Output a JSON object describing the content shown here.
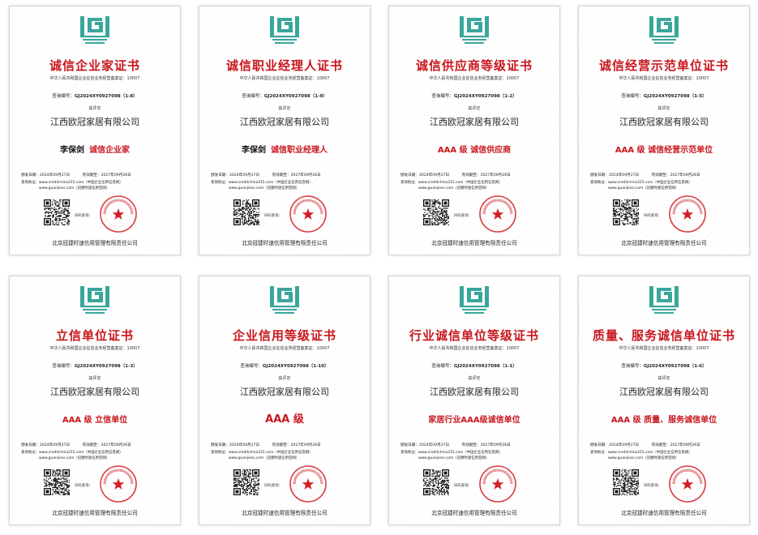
{
  "theme": {
    "title_color": "#c8161d",
    "logo_color": "#3aa69c",
    "seal_color": "#d21e26"
  },
  "certificates": [
    {
      "title": "诚信企业家证书",
      "subtitle": "中华人民共和国企业征信业务经营备案证：10007",
      "query_label": "查询编号：",
      "query_no": "GJ2024XY0927098（1-8）",
      "awarded_label": "兹评定",
      "company": "江西欧冠家居有限公司",
      "person": "李保剑",
      "honor": "诚信企业家",
      "issue_label": "颁发日期：",
      "issue_date": "2024年09月27日",
      "valid_label": "有效期至：",
      "valid_date": "2027年09月26日",
      "site_label": "查询地址：",
      "site_1": "www.creditchina315.com（中国企业信用信息网）",
      "site_2": "www.guanjiess.com（冠捷时速信用官网）",
      "scan_label": "扫码查询：",
      "issuer": "北京冠捷时速信用管理有限责任公司",
      "logo_icon": "organization-logo-icon",
      "qr_icon": "qr-code-icon",
      "seal_icon": "red-seal-stamp-icon"
    },
    {
      "title": "诚信职业经理人证书",
      "subtitle": "中华人民共和国企业征信业务经营备案证：10007",
      "query_label": "查询编号：",
      "query_no": "GJ2024XY0927098（1-9）",
      "awarded_label": "兹评定",
      "company": "江西欧冠家居有限公司",
      "person": "李保剑",
      "honor": "诚信职业经理人",
      "issue_label": "颁发日期：",
      "issue_date": "2024年09月27日",
      "valid_label": "有效期至：",
      "valid_date": "2027年09月26日",
      "site_label": "查询地址：",
      "site_1": "www.creditchina315.com（中国企业信用信息网）",
      "site_2": "www.guanjiess.com（冠捷时速信用官网）",
      "scan_label": "扫码查询：",
      "issuer": "北京冠捷时速信用管理有限责任公司",
      "logo_icon": "organization-logo-icon",
      "qr_icon": "qr-code-icon",
      "seal_icon": "red-seal-stamp-icon"
    },
    {
      "title": "诚信供应商等级证书",
      "subtitle": "中华人民共和国企业征信业务经营备案证：10007",
      "query_label": "查询编号：",
      "query_no": "GJ2024XY0927098（1-2）",
      "awarded_label": "兹评定",
      "company": "江西欧冠家居有限公司",
      "person": "",
      "honor": "AAA 级  诚信供应商",
      "issue_label": "颁发日期：",
      "issue_date": "2024年09月27日",
      "valid_label": "有效期至：",
      "valid_date": "2027年09月26日",
      "site_label": "查询地址：",
      "site_1": "www.creditchina315.com（中国企业信用信息网）",
      "site_2": "www.guanjiess.com（冠捷时速信用官网）",
      "scan_label": "扫码查询：",
      "issuer": "北京冠捷时速信用管理有限责任公司",
      "logo_icon": "organization-logo-icon",
      "qr_icon": "qr-code-icon",
      "seal_icon": "red-seal-stamp-icon"
    },
    {
      "title": "诚信经营示范单位证书",
      "subtitle": "中华人民共和国企业征信业务经营备案证：10007",
      "query_label": "查询编号：",
      "query_no": "GJ2024XY0927098（1-5）",
      "awarded_label": "兹评定",
      "company": "江西欧冠家居有限公司",
      "person": "",
      "honor": "AAA 级  诚信经营示范单位",
      "issue_label": "颁发日期：",
      "issue_date": "2024年09月27日",
      "valid_label": "有效期至：",
      "valid_date": "2027年09月26日",
      "site_label": "查询地址：",
      "site_1": "www.creditchina315.com（中国企业信用信息网）",
      "site_2": "www.guanjiess.com（冠捷时速信用官网）",
      "scan_label": "扫码查询：",
      "issuer": "北京冠捷时速信用管理有限责任公司",
      "logo_icon": "organization-logo-icon",
      "qr_icon": "qr-code-icon",
      "seal_icon": "red-seal-stamp-icon"
    },
    {
      "title": "立信单位证书",
      "subtitle": "中华人民共和国企业征信业务经营备案证：10007",
      "query_label": "查询编号：",
      "query_no": "GJ2024XY0927098（1-3）",
      "awarded_label": "兹评定",
      "company": "江西欧冠家居有限公司",
      "person": "",
      "honor": "AAA 级  立信单位",
      "issue_label": "颁发日期：",
      "issue_date": "2024年09月27日",
      "valid_label": "有效期至：",
      "valid_date": "2027年09月26日",
      "site_label": "查询地址：",
      "site_1": "www.creditchina315.com（中国企业信用信息网）",
      "site_2": "www.guanjiess.com（冠捷时速信用官网）",
      "scan_label": "扫码查询：",
      "issuer": "北京冠捷时速信用管理有限责任公司",
      "logo_icon": "organization-logo-icon",
      "qr_icon": "qr-code-icon",
      "seal_icon": "red-seal-stamp-icon"
    },
    {
      "title": "企业信用等级证书",
      "subtitle": "中华人民共和国企业征信业务经营备案证：10007",
      "query_label": "查询编号：",
      "query_no": "GJ2024XY0927098（1-10）",
      "awarded_label": "兹评定",
      "company": "江西欧冠家居有限公司",
      "person": "",
      "honor": "AAA 级",
      "issue_label": "颁发日期：",
      "issue_date": "2024年09月27日",
      "valid_label": "有效期至：",
      "valid_date": "2027年09月26日",
      "site_label": "查询地址：",
      "site_1": "www.creditchina315.com（中国企业信用信息网）",
      "site_2": "www.guanjiess.com（冠捷时速信用官网）",
      "scan_label": "扫码查询：",
      "issuer": "北京冠捷时速信用管理有限责任公司",
      "logo_icon": "organization-logo-icon",
      "qr_icon": "qr-code-icon",
      "seal_icon": "red-seal-stamp-icon"
    },
    {
      "title": "行业诚信单位等级证书",
      "subtitle": "中华人民共和国企业征信业务经营备案证：10007",
      "query_label": "查询编号：",
      "query_no": "GJ2024XY0927098（1-1）",
      "awarded_label": "兹评定",
      "company": "江西欧冠家居有限公司",
      "person": "",
      "honor": "家居行业AAA级诚信单位",
      "issue_label": "颁发日期：",
      "issue_date": "2024年09月27日",
      "valid_label": "有效期至：",
      "valid_date": "2027年09月26日",
      "site_label": "查询地址：",
      "site_1": "www.creditchina315.com（中国企业信用信息网）",
      "site_2": "www.guanjiess.com（冠捷时速信用官网）",
      "scan_label": "扫码查询：",
      "issuer": "北京冠捷时速信用管理有限责任公司",
      "logo_icon": "organization-logo-icon",
      "qr_icon": "qr-code-icon",
      "seal_icon": "red-seal-stamp-icon"
    },
    {
      "title": "质量、服务诚信单位证书",
      "subtitle": "中华人民共和国企业征信业务经营备案证：10007",
      "query_label": "查询编号：",
      "query_no": "GJ2024XY0927098（1-6）",
      "awarded_label": "兹评定",
      "company": "江西欧冠家居有限公司",
      "person": "",
      "honor": "AAA 级  质量、服务诚信单位",
      "issue_label": "颁发日期：",
      "issue_date": "2024年09月27日",
      "valid_label": "有效期至：",
      "valid_date": "2027年09月26日",
      "site_label": "查询地址：",
      "site_1": "www.creditchina315.com（中国企业信用信息网）",
      "site_2": "www.guanjiess.com（冠捷时速信用官网）",
      "scan_label": "扫码查询：",
      "issuer": "北京冠捷时速信用管理有限责任公司",
      "logo_icon": "organization-logo-icon",
      "qr_icon": "qr-code-icon",
      "seal_icon": "red-seal-stamp-icon"
    }
  ]
}
